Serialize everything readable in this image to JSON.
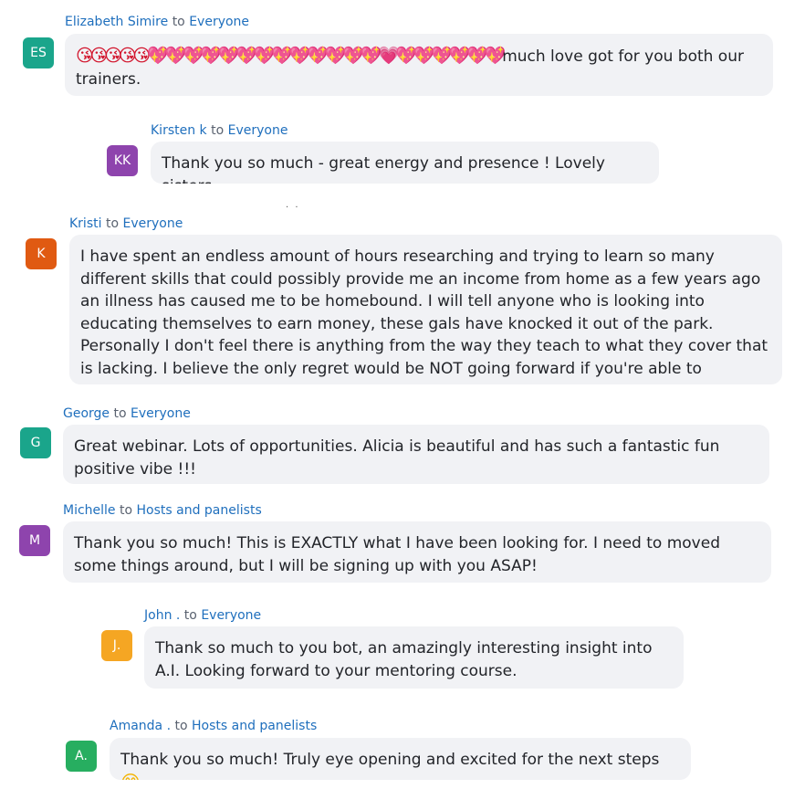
{
  "messages": [
    {
      "sender": "Elizabeth Simire",
      "to_word": "to",
      "target": "Everyone",
      "initials": "ES",
      "avatar_color": "#1aa58b",
      "emojis": "😘😘😘😘😘💖💖💖💖💖💖💖💖💖💖💖💖💖💗💖💖💖💖💖💖",
      "text": "much love got for you both our trainers."
    },
    {
      "sender": "Kirsten k",
      "to_word": "to",
      "target": "Everyone",
      "initials": "KK",
      "avatar_color": "#8e44ad",
      "text": "Thank you so much - great energy and presence ! Lovely sisters"
    },
    {
      "sender": "Kristi",
      "to_word": "to",
      "target": "Everyone",
      "initials": "K",
      "avatar_color": "#e05a12",
      "text": "I have spent an endless amount of hours researching and trying to learn so many different skills that could possibly provide me an income from home as a few years ago an illness has caused me to be homebound.  I will tell anyone who is looking into educating themselves to earn money, these gals have knocked it out of the park.  Personally I don't feel there is anything from the way they teach to what they cover that is lacking.  I believe the only regret would be NOT going forward if you're able to"
    },
    {
      "sender": "George",
      "to_word": "to",
      "target": "Everyone",
      "initials": "G",
      "avatar_color": "#1aa58b",
      "text": "Great webinar. Lots of opportunities. Alicia is beautiful and has such a fantastic fun positive vibe !!!"
    },
    {
      "sender": "Michelle",
      "to_word": "to",
      "target": "Hosts and panelists",
      "initials": "M",
      "avatar_color": "#8e44ad",
      "text": "Thank you so much! This is EXACTLY what I have been looking for.  I need to moved some things around, but I will be signing up with you ASAP!"
    },
    {
      "sender": "John .",
      "to_word": "to",
      "target": "Everyone",
      "initials": "J.",
      "avatar_color": "#f5a623",
      "text": "Thank so much to you bot, an amazingly interesting insight into A.I. Looking forward to your mentoring course."
    },
    {
      "sender": "Amanda .",
      "to_word": "to",
      "target": "Hosts and panelists",
      "initials": "A.",
      "avatar_color": "#27ae60",
      "text": "Thank you so much! Truly eye opening and excited  for the next steps",
      "trailing_emoji": "😊"
    }
  ],
  "separator_dots": ". ."
}
